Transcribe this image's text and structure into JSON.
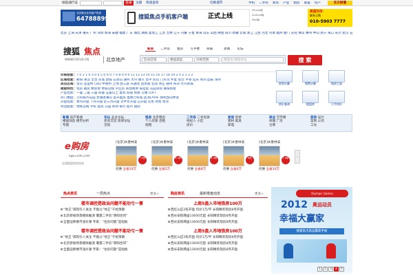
{
  "topbar": {
    "label": "搜狐通行证",
    "login": "登录",
    "register": "注册",
    "hotline": "快速查询",
    "city_switch": "切换城市",
    "links": [
      "手机",
      "二手房",
      "新房",
      "产业",
      "租房",
      "家居",
      "房产"
    ],
    "promo": "东方财富"
  },
  "ad_left": {
    "line": "北京焦点全天客户热线",
    "number": "64788899"
  },
  "ad_center": {
    "brand": "搜狐焦点手机客户端",
    "status": "正式上线",
    "ios": "iPhone版",
    "android": "Android版",
    "ipad": "iPad版",
    "ipad_note": "iPad版"
  },
  "ad_right": {
    "line1": "买房5日·",
    "line2": "联系订购",
    "phone": "010-5903 7777",
    "note": "拨打热线"
  },
  "cities": "北京 上海 天津 重庆 广州 深圳 珠海 安徽 福建 广东 湖北 湖南 黑龙江 江苏 吉林 辽宁 内蒙 宁夏 青海 山东 山西 陕西 四川 新疆 云南 浙江 江西 河北 河南 福州 厦门 东莞 佛山 惠州 中山 南宁 海口 长沙 武汉 石家庄 济南 郑州 合肥 南京 苏州 杭州 宁波 贵阳 更多",
  "logo": {
    "main": "搜狐",
    "sub": "焦点",
    "url": "WWW.FOCUS.CN",
    "city": "北京地产"
  },
  "nav": {
    "tabs": [
      "新房",
      "二手房",
      "租房",
      "写字楼",
      "商铺",
      "新闻",
      "论坛"
    ],
    "active": 0,
    "select1": "区县区域",
    "select2": "楼盘类型",
    "select3": "价格范围",
    "placeholder": "楼盘名/楼盘地址",
    "search": "搜 索"
  },
  "filters": [
    {
      "label": "价格检索：",
      "items": "7 0 2 1 0 3 0 4 5 0 6 0 7 0 8 0 9 0 11 12 13 14 15 16 17 18 19 2 0 2 1 2 2"
    },
    {
      "label": "区域检索：",
      "items": "朝阳 海淀 丰台 东城 西城 石景山 通州 大兴 顺义 昌平 房山 门头沟 怀柔 密云 平谷 延庆 燕郊 固安 涿州"
    },
    {
      "label": "热点区域：",
      "items": "望京 亚运村 CBD 中关村 上地 西三旗 天通苑 回龙观 北苑 亦庄 通州 燕郊 大兴新城"
    },
    {
      "label": "楼盘特色：",
      "items": "现房 期房 精装修 地铁沿线 学区房 商住两用 低密度 花园洋房 联排别墅"
    }
  ],
  "filter_rows": [
    "户型检索：一居 二居 三居 四居 五居以上 复式 跃层 别墅 公寓 LOFT",
    "热门楼盘：万科城市花园 龙湖滟澜山 首开国风 金隅万科城 远洋LAVIE 保利西山林语",
    "开盘检索：本月开盘 下月开盘 近三月开盘 近半年开盘 已开盘 在售 待售 售完",
    "周边配套：地铁沿线 学校 医院 公园 商场 银行 超市 剧院",
    "大学院校 新开盘 即将开盘 特价房 团购看房 看房团 新房"
  ],
  "tools": [
    {
      "name": "房贷计算"
    },
    {
      "name": "税费计算"
    },
    {
      "name": "购房工具"
    },
    {
      "name": "房价查询"
    },
    {
      "name": "楼盘库"
    },
    {
      "name": "二手房价"
    }
  ],
  "tools_extra": [
    "认证房源",
    "导购",
    "问答"
  ],
  "quicklinks": [
    [
      "新闻",
      "房产新闻",
      "楼盘动态",
      "楼市分析",
      "专题"
    ],
    [
      "论坛",
      "业主论坛",
      "买房交流",
      "装修论坛",
      "活动"
    ],
    [
      "租房",
      "北京租房",
      "个人房源",
      "合租",
      "短租"
    ],
    [
      "二手房",
      "二手房源",
      "经纪人",
      "小区",
      "房价"
    ],
    [
      "家居",
      "装修",
      "建材",
      "家具",
      "家电"
    ],
    [
      "商业",
      "写字楼",
      "商铺",
      "厂房",
      "仓库"
    ],
    [
      "装饰",
      "设计",
      "案例",
      "公司",
      "工长"
    ]
  ],
  "eagou": {
    "title": "e购房",
    "url": "egou.sohu.com",
    "slogan": "全国楼盘购房热卖"
  },
  "listings": [
    {
      "name": "[北京]水墨林溪",
      "price": "7.9折",
      "tag": "优惠",
      "save": "立省10万"
    },
    {
      "name": "[北京]水墨林溪",
      "price": "9.5折",
      "tag": "优惠",
      "save": "立省5万"
    },
    {
      "name": "[北京]水墨林溪",
      "price": "4.9折",
      "tag": "优惠",
      "save": "立省8万"
    },
    {
      "name": "[北京]水墨林溪",
      "price": "8折",
      "tag": "优惠",
      "save": "立省6万"
    },
    {
      "name": "[北京]水墨林溪",
      "price": "7.9折",
      "tag": "优惠",
      "save": "立省10万"
    }
  ],
  "col1": {
    "tabs": [
      "热点资讯",
      "一周热点"
    ],
    "more": "更多>",
    "headline1": "楼市调控是政治问题不能功亏一篑",
    "items1": [
      "“地王”再现引人关注 不能以“地王”干扰预期",
      "北京新规场景模拟推演 遭遇二手房“阴阳合同”",
      "全国迫降楼市涨价潮 专家：“住房问题”是短板"
    ],
    "headline2": "楼市调控是政治问题不能功亏一篑",
    "items2": [
      "“地王”再现引人关注 不能以“地王”干扰预期",
      "北京新规场景模拟推演 遭遇二手房“阴阳合同”",
      "全国迫降楼市涨价潮 专家：“住房问题”是短板"
    ]
  },
  "col2": {
    "tabs": [
      "购房资讯",
      "最新楼盘动态"
    ],
    "more": "更多>",
    "headline1": "上周5盘入市地铁房100万",
    "items1": [
      "西红山庄2栋开盘 均价1万/平 长阳精装现房8月开盘",
      "西长安街两居13600元起 长阳精装现房8月开盘",
      "西长安街两居13600元起 长阳精装现房8月开盘"
    ],
    "headline2": "上周5盘入市地铁房100万",
    "items2": [
      "西红山庄2栋开盘 均价1万/平 长阳精装现房8月开盘",
      "西长安街两居13600元起 长阳精装现房8月开盘",
      "西长安街两居13600元起 长阳精装现房8月开盘"
    ]
  },
  "olympic": {
    "top": "Olympic Games",
    "year": "2012",
    "sub": "奥运动员",
    "big": "幸福大赢家",
    "banner": "搜狐焦点奥运赢家手册",
    "pages": [
      "1",
      "2",
      "3",
      "4",
      "5"
    ],
    "active": 3
  },
  "colors": {
    "accent": "#d71d1d",
    "link": "#13419b",
    "nav_bg": "#234d83"
  }
}
